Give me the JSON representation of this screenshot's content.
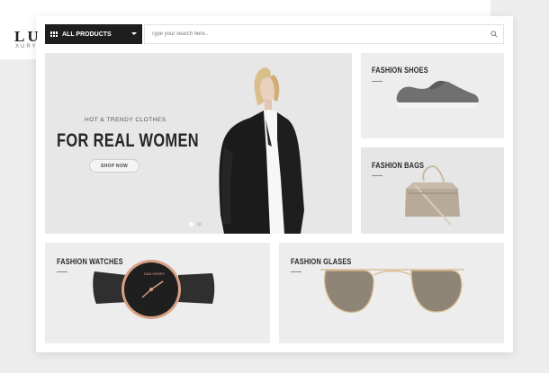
{
  "logo": {
    "text": "LU",
    "subtext": "XURY"
  },
  "nav": {
    "all_products_label": "ALL PRODUCTS",
    "search_placeholder": "Type your search here.."
  },
  "hero": {
    "eyebrow": "HOT & TRENDY CLOTHES",
    "title": "FOR REAL WOMEN",
    "cta_label": "SHOP NOW"
  },
  "categories": {
    "shoes": "FASHION SHOES",
    "bags": "FASHION BAGS",
    "watches": "FASHION WATCHES",
    "glasses": "FASHION GLASES"
  },
  "colors": {
    "nav_dark": "#1e1e1e",
    "tile_bg": "#ededee",
    "page_bg": "#ffffff"
  },
  "icons": {
    "search": "search-icon",
    "menu": "grid-icon",
    "dropdown": "caret-down-icon"
  }
}
